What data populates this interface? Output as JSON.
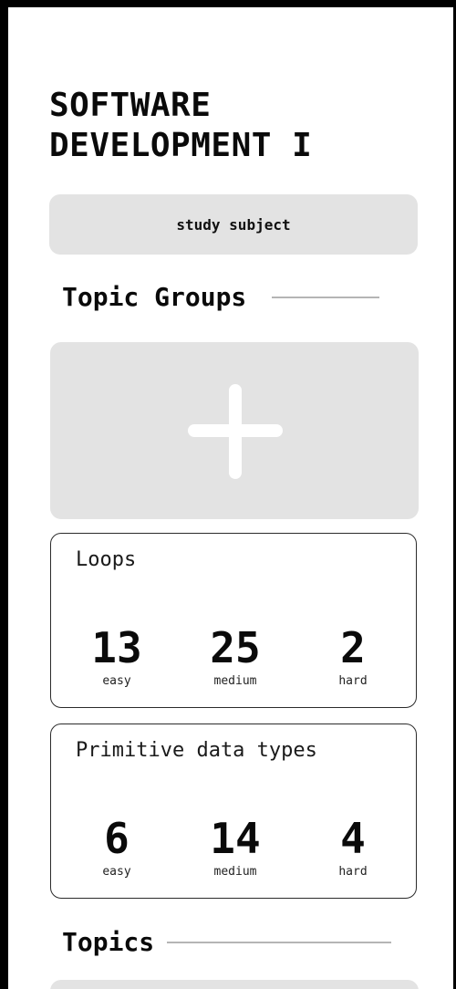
{
  "subject": {
    "title": "SOFTWARE DEVELOPMENT I",
    "chip_label": "study subject"
  },
  "sections": {
    "topic_groups": "Topic Groups",
    "topics": "Topics"
  },
  "add_group": {
    "icon": "plus-icon"
  },
  "groups": [
    {
      "name": "Loops",
      "stats": [
        {
          "value": "13",
          "label": "easy"
        },
        {
          "value": "25",
          "label": "medium"
        },
        {
          "value": "2",
          "label": "hard"
        }
      ]
    },
    {
      "name": "Primitive data types",
      "stats": [
        {
          "value": "6",
          "label": "easy"
        },
        {
          "value": "14",
          "label": "medium"
        },
        {
          "value": "4",
          "label": "hard"
        }
      ]
    }
  ],
  "colors": {
    "card_fill": "#e3e3e3",
    "text": "#0a0a0a",
    "rule": "#b5b5b5"
  }
}
